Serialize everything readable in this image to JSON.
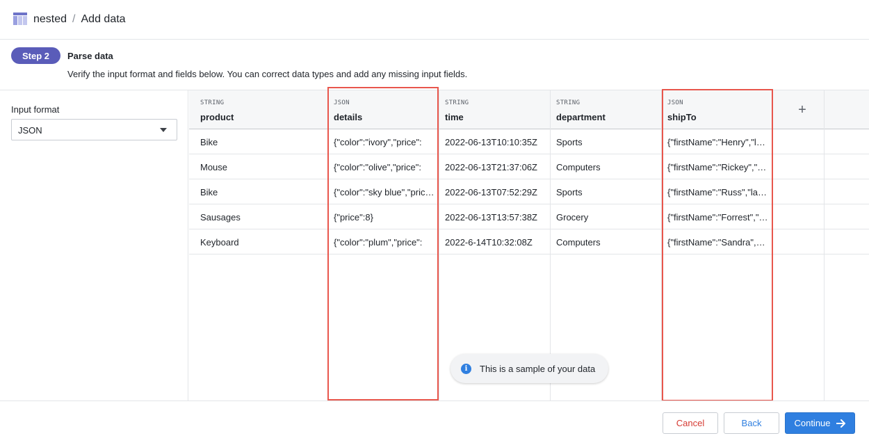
{
  "header": {
    "breadcrumb": [
      "nested",
      "Add data"
    ],
    "separator": "/"
  },
  "step": {
    "pill": "Step 2",
    "title": "Parse data",
    "description": "Verify the input format and fields below. You can correct data types and add any missing input fields."
  },
  "input_format": {
    "label": "Input format",
    "value": "JSON"
  },
  "table": {
    "columns": [
      {
        "type": "STRING",
        "name": "product"
      },
      {
        "type": "JSON",
        "name": "details"
      },
      {
        "type": "STRING",
        "name": "time"
      },
      {
        "type": "STRING",
        "name": "department"
      },
      {
        "type": "JSON",
        "name": "shipTo"
      }
    ],
    "rows": [
      [
        "Bike",
        "{\"color\":\"ivory\",\"price\":",
        "2022-06-13T10:10:35Z",
        "Sports",
        "{\"firstName\":\"Henry\",\"lastName\":"
      ],
      [
        "Mouse",
        "{\"color\":\"olive\",\"price\":",
        "2022-06-13T21:37:06Z",
        "Computers",
        "{\"firstName\":\"Rickey\",\"lastName\":"
      ],
      [
        "Bike",
        "{\"color\":\"sky blue\",\"price\":",
        "2022-06-13T07:52:29Z",
        "Sports",
        "{\"firstName\":\"Russ\",\"lastName\":"
      ],
      [
        "Sausages",
        "{\"price\":8}",
        "2022-06-13T13:57:38Z",
        "Grocery",
        "{\"firstName\":\"Forrest\",\"lastName\":"
      ],
      [
        "Keyboard",
        "{\"color\":\"plum\",\"price\":",
        "2022-6-14T10:32:08Z",
        "Computers",
        "{\"firstName\":\"Sandra\",\"lastName\":"
      ]
    ],
    "add_column_label": "+"
  },
  "toast": {
    "icon": "info-icon",
    "message": "This is a sample of your data"
  },
  "footer": {
    "cancel_label": "Cancel",
    "back_label": "Back",
    "continue_label": "Continue"
  },
  "colors": {
    "accent": "#2f7fe0",
    "step_pill": "#5a5cb9",
    "cancel_text": "#d63a32",
    "highlight": "#e8564c"
  }
}
